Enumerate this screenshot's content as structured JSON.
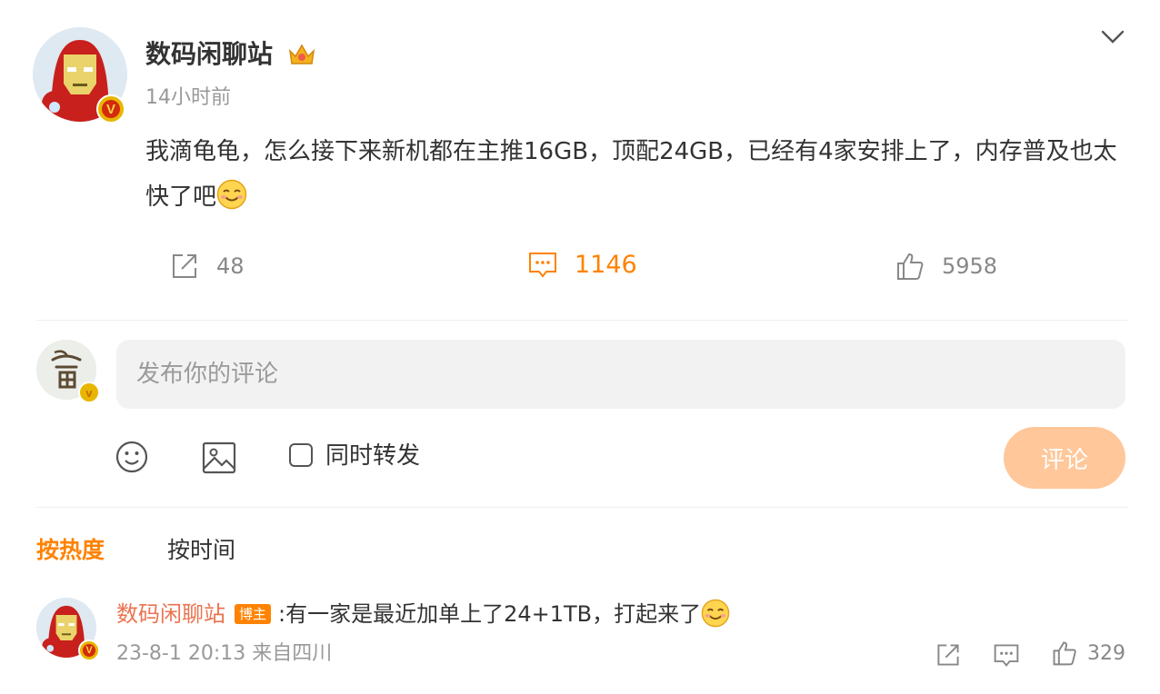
{
  "post": {
    "username": "数码闲聊站",
    "time": "14小时前",
    "content": "我滴龟龟，怎么接下来新机都在主推16GB，顶配24GB，已经有4家安排上了，内存普及也太快了吧",
    "actions": {
      "reposts": "48",
      "comments": "1146",
      "likes": "5958"
    }
  },
  "composer": {
    "placeholder": "发布你的评论",
    "repost_label": "同时转发",
    "submit_label": "评论"
  },
  "sort_tabs": {
    "hot": "按热度",
    "time": "按时间"
  },
  "comments": [
    {
      "username": "数码闲聊站",
      "tag": "博主",
      "text": ":有一家是最近加单上了24+1TB，打起来了",
      "meta": "23-8-1 20:13 来自四川",
      "likes": "329"
    }
  ],
  "colors": {
    "accent": "#ff8200",
    "submit_disabled": "#ffc79a",
    "comment_username": "#eb7350"
  },
  "icons": [
    "ironman-avatar",
    "verified-v-badge",
    "crown-icon",
    "chevron-down-icon",
    "repost-icon",
    "comment-icon",
    "like-icon",
    "emoji-icon",
    "image-icon",
    "smile-emoji"
  ]
}
